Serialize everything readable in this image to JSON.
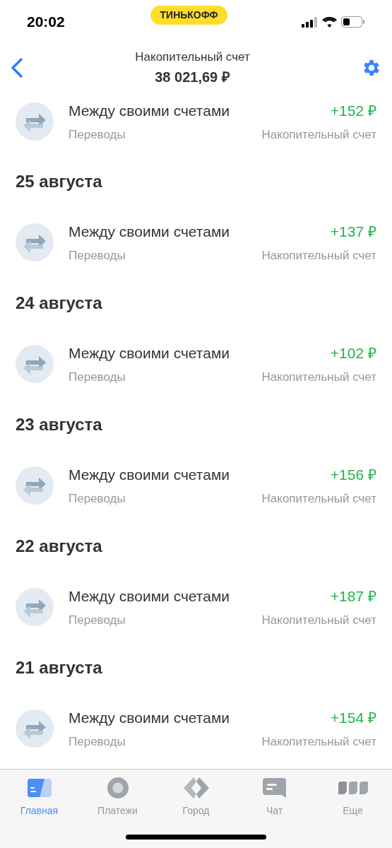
{
  "status_bar": {
    "time": "20:02",
    "badge": "ТИНЬКОФФ"
  },
  "header": {
    "title": "Накопительный счет",
    "balance": "38 021,69 ₽"
  },
  "feed": [
    {
      "kind": "transaction",
      "title": "Между своими счетами",
      "category": "Переводы",
      "amount": "+152 ₽",
      "account": "Накопительный счет"
    },
    {
      "kind": "date",
      "label": "25 августа"
    },
    {
      "kind": "transaction",
      "title": "Между своими счетами",
      "category": "Переводы",
      "amount": "+137 ₽",
      "account": "Накопительный счет"
    },
    {
      "kind": "date",
      "label": "24 августа"
    },
    {
      "kind": "transaction",
      "title": "Между своими счетами",
      "category": "Переводы",
      "amount": "+102 ₽",
      "account": "Накопительный счет"
    },
    {
      "kind": "date",
      "label": "23 августа"
    },
    {
      "kind": "transaction",
      "title": "Между своими счетами",
      "category": "Переводы",
      "amount": "+156 ₽",
      "account": "Накопительный счет"
    },
    {
      "kind": "date",
      "label": "22 августа"
    },
    {
      "kind": "transaction",
      "title": "Между своими счетами",
      "category": "Переводы",
      "amount": "+187 ₽",
      "account": "Накопительный счет"
    },
    {
      "kind": "date",
      "label": "21 августа"
    },
    {
      "kind": "transaction",
      "title": "Между своими счетами",
      "category": "Переводы",
      "amount": "+154 ₽",
      "account": "Накопительный счет"
    }
  ],
  "tabs": [
    {
      "kind": "home",
      "label": "Главная",
      "selected": true
    },
    {
      "kind": "payments",
      "label": "Платежи",
      "selected": false
    },
    {
      "kind": "city",
      "label": "Город",
      "selected": false
    },
    {
      "kind": "chat",
      "label": "Чат",
      "selected": false
    },
    {
      "kind": "more",
      "label": "Еще",
      "selected": false
    }
  ]
}
